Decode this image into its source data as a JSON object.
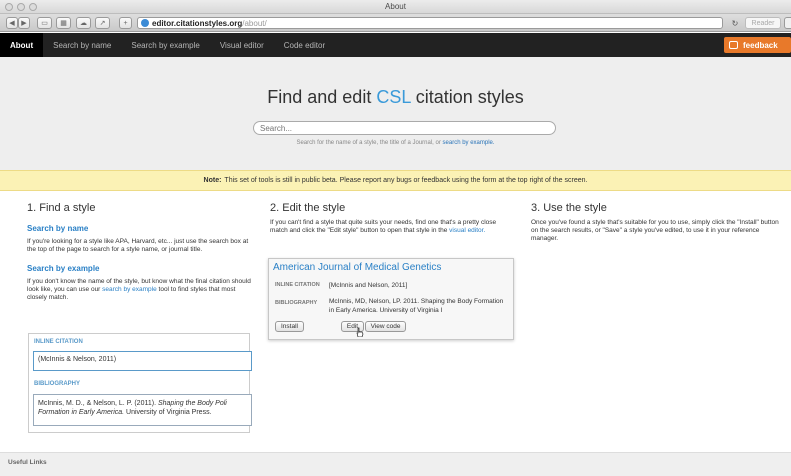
{
  "window": {
    "title": "About"
  },
  "browser": {
    "url_host": "editor.citationstyles.org",
    "url_path": "/about/",
    "reader_label": "Reader"
  },
  "nav": {
    "tabs": [
      "About",
      "Search by name",
      "Search by example",
      "Visual editor",
      "Code editor"
    ],
    "active": "About",
    "feedback_label": "feedback"
  },
  "hero": {
    "title_before": "Find and edit ",
    "title_accent": "CSL",
    "title_after": " citation styles",
    "search_placeholder": "Search...",
    "hint_text": "Search for the name of a style, the title of a Journal, or ",
    "hint_link": "search by example."
  },
  "note": {
    "label": "Note:",
    "text": "This set of tools is still in public beta. Please report any bugs or feedback using the form at the top right of the screen."
  },
  "col1": {
    "heading": "1. Find a style",
    "by_name_heading": "Search by name",
    "by_name_text": "If you're looking for a style like APA, Harvard, etc... just use the search box at the top of the page to search for a style name, or journal title.",
    "by_example_heading": "Search by example",
    "by_example_text": "If you don't know the name of the style, but know what the final citation should look like, you can use our ",
    "by_example_link": "search by example",
    "by_example_tail": " tool to find styles that most closely match.",
    "inline_label": "INLINE CITATION",
    "inline_value": "(McInnis & Nelson, 2011)",
    "bib_label": "BIBLIOGRAPHY",
    "bib_plain": "McInnis, M. D., & Nelson, L. P. (2011). ",
    "bib_italic": "Shaping the Body Poli Formation in Early America.",
    "bib_tail": " University of Virginia Press."
  },
  "col2": {
    "heading": "2. Edit the style",
    "text": "If you can't find a style that quite suits your needs, find one that's a pretty close match and click the \"Edit style\" button to open that style in the ",
    "link": "visual editor.",
    "demo_title": "American Journal of Medical Genetics",
    "inline_label": "INLINE CITATION",
    "inline_value": "[McInnis and Nelson, 2011]",
    "bib_label": "BIBLIOGRAPHY",
    "bib_value": "McInnis, MD, Nelson, LP. 2011. Shaping the Body Formation in Early America. University of Virginia I",
    "install_label": "Install",
    "edit_label": "Edit",
    "view_code_label": "View code"
  },
  "col3": {
    "heading": "3. Use the style",
    "text": "Once you've found a style that's suitable for you to use, simply click the \"Install\" button on the search results, or \"Save\" a style you've edited, to use it in your reference manager."
  },
  "footer": {
    "label": "Useful Links"
  },
  "colors": {
    "accent": "#3a9ad9",
    "nav_bg": "#222222",
    "feedback": "#e8792a",
    "note_bg": "#fbf2b5"
  }
}
